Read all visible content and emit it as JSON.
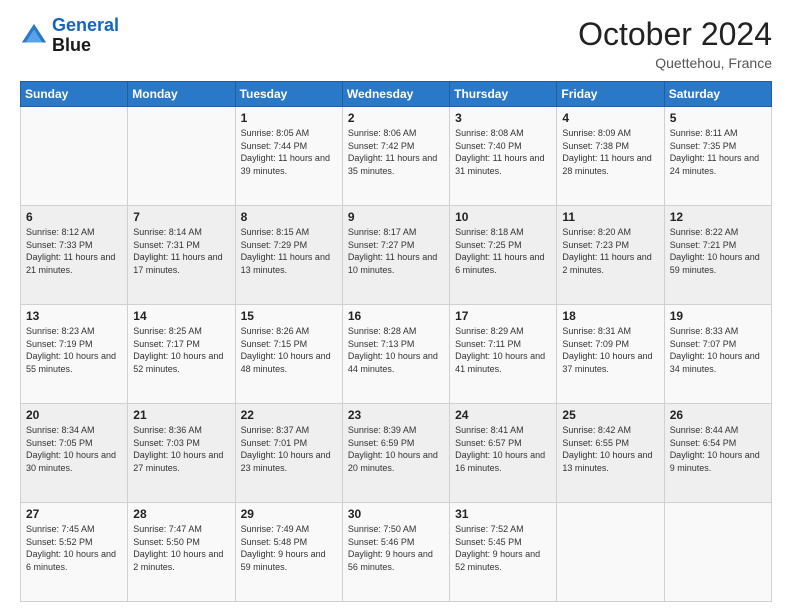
{
  "header": {
    "logo_line1": "General",
    "logo_line2": "Blue",
    "month": "October 2024",
    "location": "Quettehou, France"
  },
  "weekdays": [
    "Sunday",
    "Monday",
    "Tuesday",
    "Wednesday",
    "Thursday",
    "Friday",
    "Saturday"
  ],
  "weeks": [
    [
      {
        "day": "",
        "sunrise": "",
        "sunset": "",
        "daylight": ""
      },
      {
        "day": "",
        "sunrise": "",
        "sunset": "",
        "daylight": ""
      },
      {
        "day": "1",
        "sunrise": "Sunrise: 8:05 AM",
        "sunset": "Sunset: 7:44 PM",
        "daylight": "Daylight: 11 hours and 39 minutes."
      },
      {
        "day": "2",
        "sunrise": "Sunrise: 8:06 AM",
        "sunset": "Sunset: 7:42 PM",
        "daylight": "Daylight: 11 hours and 35 minutes."
      },
      {
        "day": "3",
        "sunrise": "Sunrise: 8:08 AM",
        "sunset": "Sunset: 7:40 PM",
        "daylight": "Daylight: 11 hours and 31 minutes."
      },
      {
        "day": "4",
        "sunrise": "Sunrise: 8:09 AM",
        "sunset": "Sunset: 7:38 PM",
        "daylight": "Daylight: 11 hours and 28 minutes."
      },
      {
        "day": "5",
        "sunrise": "Sunrise: 8:11 AM",
        "sunset": "Sunset: 7:35 PM",
        "daylight": "Daylight: 11 hours and 24 minutes."
      }
    ],
    [
      {
        "day": "6",
        "sunrise": "Sunrise: 8:12 AM",
        "sunset": "Sunset: 7:33 PM",
        "daylight": "Daylight: 11 hours and 21 minutes."
      },
      {
        "day": "7",
        "sunrise": "Sunrise: 8:14 AM",
        "sunset": "Sunset: 7:31 PM",
        "daylight": "Daylight: 11 hours and 17 minutes."
      },
      {
        "day": "8",
        "sunrise": "Sunrise: 8:15 AM",
        "sunset": "Sunset: 7:29 PM",
        "daylight": "Daylight: 11 hours and 13 minutes."
      },
      {
        "day": "9",
        "sunrise": "Sunrise: 8:17 AM",
        "sunset": "Sunset: 7:27 PM",
        "daylight": "Daylight: 11 hours and 10 minutes."
      },
      {
        "day": "10",
        "sunrise": "Sunrise: 8:18 AM",
        "sunset": "Sunset: 7:25 PM",
        "daylight": "Daylight: 11 hours and 6 minutes."
      },
      {
        "day": "11",
        "sunrise": "Sunrise: 8:20 AM",
        "sunset": "Sunset: 7:23 PM",
        "daylight": "Daylight: 11 hours and 2 minutes."
      },
      {
        "day": "12",
        "sunrise": "Sunrise: 8:22 AM",
        "sunset": "Sunset: 7:21 PM",
        "daylight": "Daylight: 10 hours and 59 minutes."
      }
    ],
    [
      {
        "day": "13",
        "sunrise": "Sunrise: 8:23 AM",
        "sunset": "Sunset: 7:19 PM",
        "daylight": "Daylight: 10 hours and 55 minutes."
      },
      {
        "day": "14",
        "sunrise": "Sunrise: 8:25 AM",
        "sunset": "Sunset: 7:17 PM",
        "daylight": "Daylight: 10 hours and 52 minutes."
      },
      {
        "day": "15",
        "sunrise": "Sunrise: 8:26 AM",
        "sunset": "Sunset: 7:15 PM",
        "daylight": "Daylight: 10 hours and 48 minutes."
      },
      {
        "day": "16",
        "sunrise": "Sunrise: 8:28 AM",
        "sunset": "Sunset: 7:13 PM",
        "daylight": "Daylight: 10 hours and 44 minutes."
      },
      {
        "day": "17",
        "sunrise": "Sunrise: 8:29 AM",
        "sunset": "Sunset: 7:11 PM",
        "daylight": "Daylight: 10 hours and 41 minutes."
      },
      {
        "day": "18",
        "sunrise": "Sunrise: 8:31 AM",
        "sunset": "Sunset: 7:09 PM",
        "daylight": "Daylight: 10 hours and 37 minutes."
      },
      {
        "day": "19",
        "sunrise": "Sunrise: 8:33 AM",
        "sunset": "Sunset: 7:07 PM",
        "daylight": "Daylight: 10 hours and 34 minutes."
      }
    ],
    [
      {
        "day": "20",
        "sunrise": "Sunrise: 8:34 AM",
        "sunset": "Sunset: 7:05 PM",
        "daylight": "Daylight: 10 hours and 30 minutes."
      },
      {
        "day": "21",
        "sunrise": "Sunrise: 8:36 AM",
        "sunset": "Sunset: 7:03 PM",
        "daylight": "Daylight: 10 hours and 27 minutes."
      },
      {
        "day": "22",
        "sunrise": "Sunrise: 8:37 AM",
        "sunset": "Sunset: 7:01 PM",
        "daylight": "Daylight: 10 hours and 23 minutes."
      },
      {
        "day": "23",
        "sunrise": "Sunrise: 8:39 AM",
        "sunset": "Sunset: 6:59 PM",
        "daylight": "Daylight: 10 hours and 20 minutes."
      },
      {
        "day": "24",
        "sunrise": "Sunrise: 8:41 AM",
        "sunset": "Sunset: 6:57 PM",
        "daylight": "Daylight: 10 hours and 16 minutes."
      },
      {
        "day": "25",
        "sunrise": "Sunrise: 8:42 AM",
        "sunset": "Sunset: 6:55 PM",
        "daylight": "Daylight: 10 hours and 13 minutes."
      },
      {
        "day": "26",
        "sunrise": "Sunrise: 8:44 AM",
        "sunset": "Sunset: 6:54 PM",
        "daylight": "Daylight: 10 hours and 9 minutes."
      }
    ],
    [
      {
        "day": "27",
        "sunrise": "Sunrise: 7:45 AM",
        "sunset": "Sunset: 5:52 PM",
        "daylight": "Daylight: 10 hours and 6 minutes."
      },
      {
        "day": "28",
        "sunrise": "Sunrise: 7:47 AM",
        "sunset": "Sunset: 5:50 PM",
        "daylight": "Daylight: 10 hours and 2 minutes."
      },
      {
        "day": "29",
        "sunrise": "Sunrise: 7:49 AM",
        "sunset": "Sunset: 5:48 PM",
        "daylight": "Daylight: 9 hours and 59 minutes."
      },
      {
        "day": "30",
        "sunrise": "Sunrise: 7:50 AM",
        "sunset": "Sunset: 5:46 PM",
        "daylight": "Daylight: 9 hours and 56 minutes."
      },
      {
        "day": "31",
        "sunrise": "Sunrise: 7:52 AM",
        "sunset": "Sunset: 5:45 PM",
        "daylight": "Daylight: 9 hours and 52 minutes."
      },
      {
        "day": "",
        "sunrise": "",
        "sunset": "",
        "daylight": ""
      },
      {
        "day": "",
        "sunrise": "",
        "sunset": "",
        "daylight": ""
      }
    ]
  ]
}
